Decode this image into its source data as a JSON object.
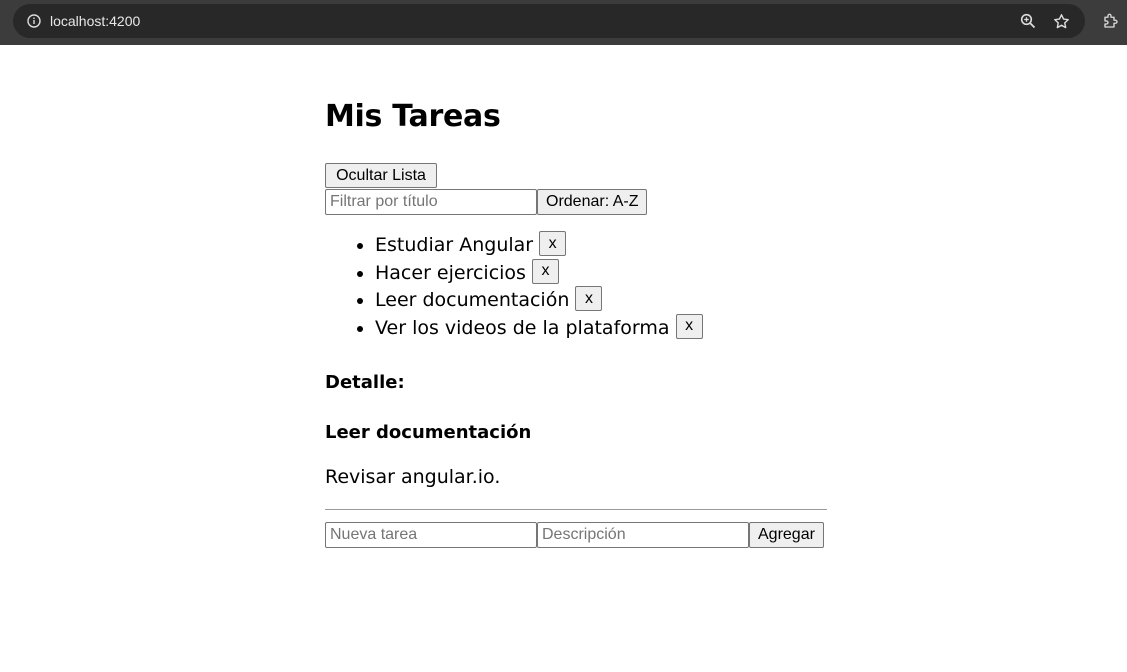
{
  "browser": {
    "url": "localhost:4200",
    "icons": [
      "info-icon",
      "zoom-icon",
      "star-icon",
      "extensions-icon"
    ]
  },
  "app": {
    "title": "Mis Tareas",
    "toggle_label": "Ocultar Lista",
    "filter": {
      "placeholder": "Filtrar por título",
      "value": ""
    },
    "sort_label": "Ordenar: A-Z",
    "tasks": [
      {
        "title": "Estudiar Angular",
        "delete_label": "x"
      },
      {
        "title": "Hacer ejercicios",
        "delete_label": "x"
      },
      {
        "title": "Leer documentación",
        "delete_label": "x"
      },
      {
        "title": "Ver los videos de la plataforma",
        "delete_label": "x"
      }
    ],
    "detail": {
      "heading": "Detalle:",
      "title": "Leer documentación",
      "description": "Revisar angular.io."
    },
    "new_task": {
      "title_placeholder": "Nueva tarea",
      "description_placeholder": "Descripción",
      "add_label": "Agregar"
    }
  },
  "colors": {
    "chrome_bg": "#3c3c3c",
    "omnibox_bg": "#282828",
    "button_bg": "#efefef",
    "border": "#767676"
  }
}
